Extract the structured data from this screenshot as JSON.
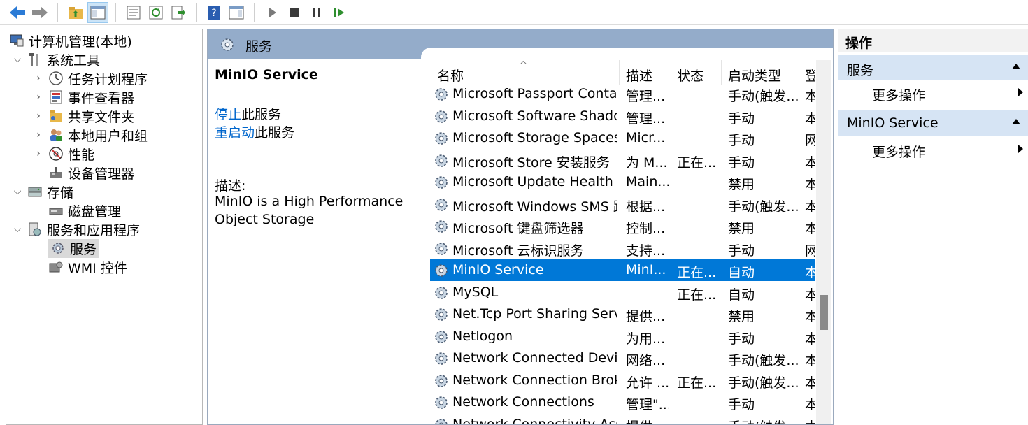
{
  "toolbar": {
    "icons": [
      "back-arrow-icon",
      "forward-arrow-icon",
      "up-folder-icon",
      "show-hide-tree-icon",
      "properties-icon",
      "refresh-icon",
      "export-list-icon",
      "help-icon",
      "show-action-pane-icon",
      "play-icon",
      "stop-icon",
      "pause-icon",
      "resume-icon"
    ]
  },
  "tree": {
    "root": "计算机管理(本地)",
    "system_tools": "系统工具",
    "task_scheduler": "任务计划程序",
    "event_viewer": "事件查看器",
    "shared_folders": "共享文件夹",
    "local_users": "本地用户和组",
    "performance": "性能",
    "device_manager": "设备管理器",
    "storage": "存储",
    "disk_management": "磁盘管理",
    "services_apps": "服务和应用程序",
    "services": "服务",
    "wmi": "WMI 控件"
  },
  "middle": {
    "header_title": "服务",
    "detail": {
      "service_name": "MinIO Service",
      "stop_link": "停止",
      "stop_suffix": "此服务",
      "restart_link": "重启动",
      "restart_suffix": "此服务",
      "desc_label": "描述:",
      "desc_line1": "MinIO is a High Performance",
      "desc_line2": "Object Storage"
    },
    "columns": {
      "name": "名称",
      "desc": "描述",
      "status": "状态",
      "startup": "启动类型",
      "logon": "登"
    },
    "rows": [
      {
        "name": "Microsoft Passport Container",
        "desc": "管理...",
        "status": "",
        "startup": "手动(触发...",
        "logon": "本"
      },
      {
        "name": "Microsoft Software Shado...",
        "desc": "管理...",
        "status": "",
        "startup": "手动",
        "logon": "本"
      },
      {
        "name": "Microsoft Storage Spaces S...",
        "desc": "Micr...",
        "status": "",
        "startup": "手动",
        "logon": "网"
      },
      {
        "name": "Microsoft Store 安装服务",
        "desc": "为 M...",
        "status": "正在...",
        "startup": "手动",
        "logon": "本"
      },
      {
        "name": "Microsoft Update Health S...",
        "desc": "Main...",
        "status": "",
        "startup": "禁用",
        "logon": "本"
      },
      {
        "name": "Microsoft Windows SMS 路...",
        "desc": "根据...",
        "status": "",
        "startup": "手动(触发...",
        "logon": "本"
      },
      {
        "name": "Microsoft 键盘筛选器",
        "desc": "控制...",
        "status": "",
        "startup": "禁用",
        "logon": "本"
      },
      {
        "name": "Microsoft 云标识服务",
        "desc": "支持...",
        "status": "",
        "startup": "手动",
        "logon": "网"
      },
      {
        "name": "MinIO Service",
        "desc": "MinI...",
        "status": "正在...",
        "startup": "自动",
        "logon": "本"
      },
      {
        "name": "MySQL",
        "desc": "",
        "status": "正在...",
        "startup": "自动",
        "logon": "本"
      },
      {
        "name": "Net.Tcp Port Sharing Service",
        "desc": "提供...",
        "status": "",
        "startup": "禁用",
        "logon": "本"
      },
      {
        "name": "Netlogon",
        "desc": "为用...",
        "status": "",
        "startup": "手动",
        "logon": "本"
      },
      {
        "name": "Network Connected Devic...",
        "desc": "网络...",
        "status": "",
        "startup": "手动(触发...",
        "logon": "本"
      },
      {
        "name": "Network Connection Broker",
        "desc": "允许 ...",
        "status": "正在...",
        "startup": "手动(触发...",
        "logon": "本"
      },
      {
        "name": "Network Connections",
        "desc": "管理\"...",
        "status": "",
        "startup": "手动",
        "logon": "本"
      },
      {
        "name": "Network Connectivity Assis...",
        "desc": "提供...",
        "status": "",
        "startup": "手动(触发...",
        "logon": "本"
      }
    ],
    "selected_row": "MinIO Service"
  },
  "actions": {
    "title": "操作",
    "section1": "服务",
    "section1_more": "更多操作",
    "section2": "MinIO Service",
    "section2_more": "更多操作"
  },
  "colors": {
    "selection": "#0078d7",
    "header_band": "#94acca",
    "action_section": "#d6e4f4",
    "link": "#0066cc"
  }
}
